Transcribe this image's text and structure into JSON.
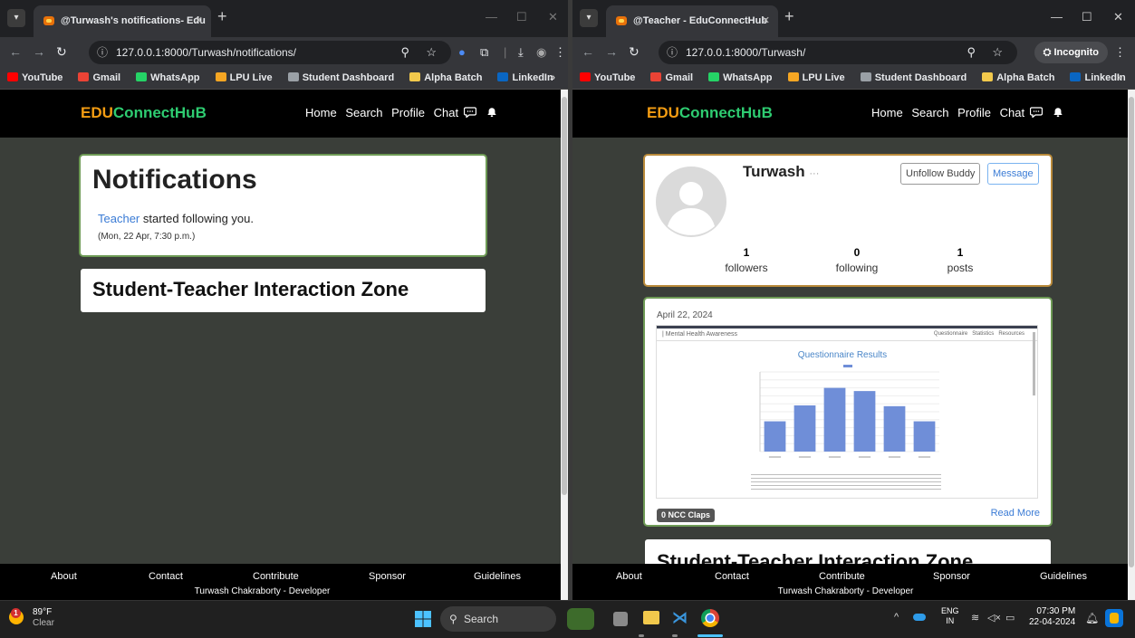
{
  "left": {
    "tab_title": "@Turwash's notifications- Edu",
    "url": "127.0.0.1:8000/Turwash/notifications/",
    "page": {
      "notifications_title": "Notifications",
      "notification": {
        "actor": "Teacher",
        "text": "started following you.",
        "time": "(Mon, 22 Apr, 7:30 p.m.)"
      },
      "zone_title": "Student-Teacher Interaction Zone"
    }
  },
  "right": {
    "tab_title": "@Teacher - EduConnectHub",
    "url": "127.0.0.1:8000/Turwash/",
    "incognito_label": "Incognito",
    "page": {
      "profile": {
        "username": "Turwash",
        "more": "···",
        "unfollow_label": "Unfollow Buddy",
        "message_label": "Message",
        "stats": [
          {
            "value": "1",
            "label": "followers"
          },
          {
            "value": "0",
            "label": "following"
          },
          {
            "value": "1",
            "label": "posts"
          }
        ]
      },
      "post": {
        "date": "April 22, 2024",
        "claps_label": "0 NCC Claps",
        "read_more": "Read More",
        "preview": {
          "header_title": "| Mental Health Awareness",
          "header_links": [
            "Questionnaire",
            "Statistics",
            "Resources"
          ],
          "chart_title": "Questionnaire Results",
          "bar_values": [
            38,
            58,
            80,
            76,
            57,
            38
          ]
        }
      },
      "zone_title": "Student-Teacher Interaction Zone"
    }
  },
  "site": {
    "brand_prefix": "EDU",
    "brand_suffix": "ConnectHuB",
    "nav": [
      "Home",
      "Search",
      "Profile",
      "Chat"
    ],
    "footer_links": [
      "About",
      "Contact",
      "Contribute",
      "Sponsor",
      "Guidelines"
    ],
    "footer_dev": "Turwash Chakraborty - Developer"
  },
  "bookmarks": [
    "YouTube",
    "Gmail",
    "WhatsApp",
    "LPU Live",
    "Student Dashboard",
    "Alpha Batch",
    "LinkedIn"
  ],
  "bookmark_colors": [
    "#ff0000",
    "#ea4335",
    "#25d366",
    "#f5a623",
    "#9aa0a6",
    "#f2c94c",
    "#0a66c2"
  ],
  "taskbar": {
    "weather_temp": "89°F",
    "weather_desc": "Clear",
    "search_label": "Search",
    "lang_top": "ENG",
    "lang_bottom": "IN",
    "time": "07:30 PM",
    "date": "22-04-2024"
  }
}
